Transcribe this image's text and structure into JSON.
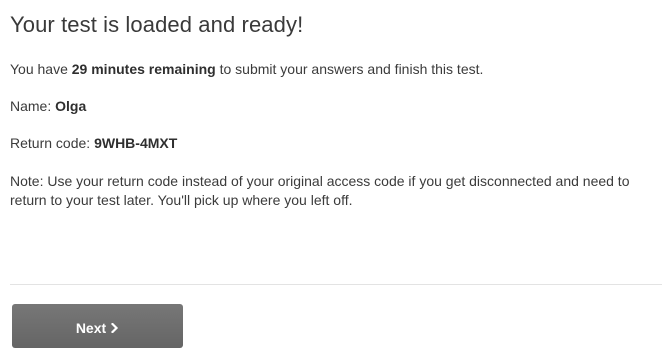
{
  "heading": "Your test is loaded and ready!",
  "time_notice": {
    "prefix": "You have ",
    "remaining": "29 minutes remaining",
    "suffix": " to submit your answers and finish this test."
  },
  "candidate": {
    "name_label": "Name: ",
    "name": "Olga"
  },
  "return_code": {
    "label": "Return code: ",
    "value": "9WHB-4MXT"
  },
  "note": "Note: Use your return code instead of your original access code if you get disconnected and need to return to your test later. You'll pick up where you left off.",
  "next_button": {
    "label": "Next",
    "icon": "chevron-right-icon"
  },
  "colors": {
    "button_background": "#6f6f6f",
    "button_text": "#ffffff",
    "body_text": "#3b3b3b",
    "divider": "#e3e3e3"
  }
}
